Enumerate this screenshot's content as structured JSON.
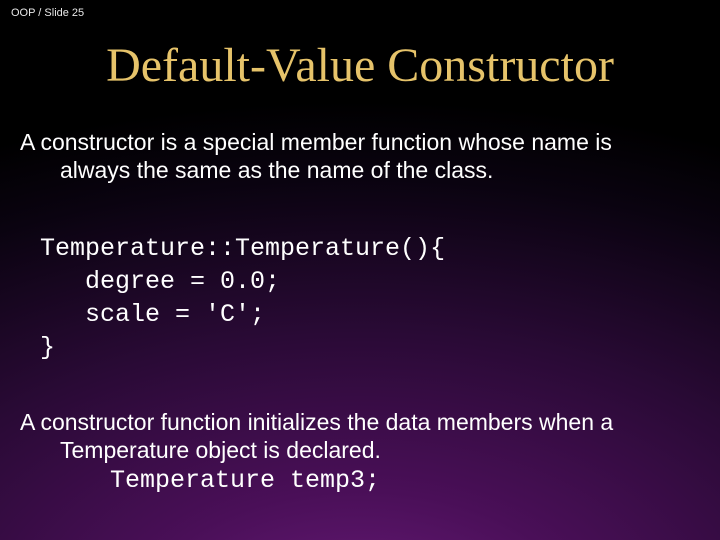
{
  "breadcrumb": "OOP / Slide 25",
  "title": "Default-Value Constructor",
  "para1_line1": "A constructor is a special member function whose name is",
  "para1_line2": "always the same as the name of the class.",
  "code": "Temperature::Temperature(){\n   degree = 0.0;\n   scale = 'C';\n}",
  "para2_line1": "A constructor function initializes the data members when a",
  "para2_line2": "Temperature object is declared.",
  "decl": "Temperature temp3;"
}
